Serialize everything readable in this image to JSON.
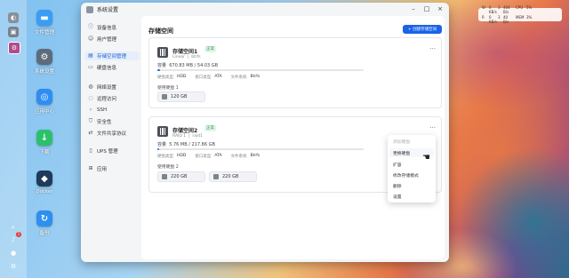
{
  "status_widget": {
    "rows": [
      {
        "k": "W",
        "a": "0 KB/s",
        "b": "3",
        "c": "404 B/s",
        "d": "CPU",
        "e": "5%"
      },
      {
        "k": "R",
        "a": "0 KB/s",
        "b": "3",
        "c": "40 B/s",
        "d": "MEM",
        "e": "3%"
      }
    ]
  },
  "desktop_apps": [
    {
      "label": "文件管理",
      "icon": "folder-icon",
      "color": "#3a9df5"
    },
    {
      "label": "系统设置",
      "icon": "gear-icon",
      "color": "#5e6b7a"
    },
    {
      "label": "应用中心",
      "icon": "app-center-icon",
      "color": "#2f8df2"
    },
    {
      "label": "下载",
      "icon": "download-icon",
      "color": "#2bc16b"
    },
    {
      "label": "Docker",
      "icon": "docker-icon",
      "color": "#1f3a5a"
    },
    {
      "label": "备份",
      "icon": "backup-icon",
      "color": "#2d8ff0"
    }
  ],
  "dock": {
    "notification_count": "1"
  },
  "window": {
    "title": "系统设置",
    "controls": {
      "min": "–",
      "max": "□",
      "close": "×"
    }
  },
  "sidebar": {
    "items": [
      {
        "label": "设备信息",
        "icon": "info-icon"
      },
      {
        "label": "用户管理",
        "icon": "user-icon"
      },
      {
        "label": "存储空间管理",
        "icon": "storage-icon",
        "active": true
      },
      {
        "label": "硬盘信息",
        "icon": "disk-icon"
      },
      {
        "label": "网络设置",
        "icon": "network-icon"
      },
      {
        "label": "远程访问",
        "icon": "remote-icon"
      },
      {
        "label": "SSH",
        "icon": "terminal-icon"
      },
      {
        "label": "安全性",
        "icon": "shield-icon"
      },
      {
        "label": "文件共享协议",
        "icon": "share-icon"
      },
      {
        "label": "UPS 管理",
        "icon": "ups-icon"
      },
      {
        "label": "应用",
        "icon": "apps-icon"
      }
    ]
  },
  "main": {
    "title": "存储空间",
    "create_button": "+ 创建存储空间"
  },
  "pools": [
    {
      "name": "存储空间1",
      "status": "正常",
      "sub1": "Linear",
      "sub2": "btrfs",
      "capacity_label": "容量",
      "capacity": "670.83 MB / 54.03 GB",
      "usage": 0.012,
      "props": {
        "type_label": "硬盘类型",
        "type": "HDD",
        "iface_label": "接口类型",
        "iface": "ATA",
        "fs_label": "文件系统",
        "fs": "Btrfs"
      },
      "disks_label": "使用硬盘 1",
      "disks": [
        "120 GB"
      ]
    },
    {
      "name": "存储空间2",
      "status": "正常",
      "sub1": "RAID 1",
      "sub2": "raid1",
      "capacity_label": "容量",
      "capacity": "5.76 MB / 217.86 GB",
      "usage": 0.0,
      "props": {
        "type_label": "硬盘类型",
        "type": "HDD",
        "iface_label": "接口类型",
        "iface": "ATA",
        "fs_label": "文件系统",
        "fs": "Btrfs"
      },
      "disks_label": "使用硬盘 2",
      "disks": [
        "220 GB",
        "220 GB"
      ]
    }
  ],
  "context_menu": {
    "items": [
      {
        "label": "添加硬盘",
        "disabled": true
      },
      {
        "label": "更换硬盘",
        "disabled": false
      },
      {
        "label": "扩容",
        "disabled": false
      },
      {
        "label": "修改存储模式",
        "disabled": false
      },
      {
        "label": "删除",
        "disabled": false
      },
      {
        "label": "设置",
        "disabled": false
      }
    ]
  }
}
